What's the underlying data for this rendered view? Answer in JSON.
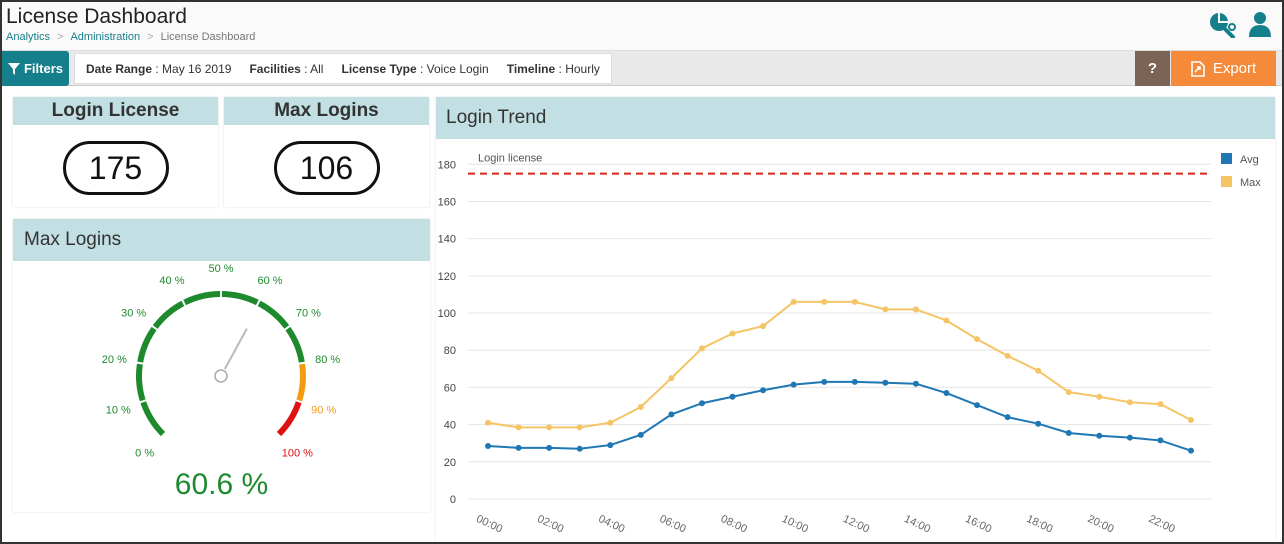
{
  "header": {
    "title": "License Dashboard",
    "breadcrumb": [
      "Analytics",
      "Administration",
      "License Dashboard"
    ],
    "breadcrumb_sep": ">"
  },
  "toolbar": {
    "filters_label": "Filters",
    "filters": [
      {
        "key": "Date Range",
        "value": "May 16 2019"
      },
      {
        "key": "Facilities",
        "value": "All"
      },
      {
        "key": "License Type",
        "value": "Voice Login"
      },
      {
        "key": "Timeline",
        "value": "Hourly"
      }
    ],
    "help_label": "?",
    "export_label": "Export"
  },
  "kpis": [
    {
      "title": "Login License",
      "value": "175"
    },
    {
      "title": "Max Logins",
      "value": "106"
    }
  ],
  "gauge": {
    "title": "Max Logins",
    "value_text": "60.6 %",
    "value": 60.6,
    "tick_labels": [
      "0 %",
      "10 %",
      "20 %",
      "30 %",
      "40 %",
      "50 %",
      "60 %",
      "70 %",
      "80 %",
      "90 %",
      "100 %"
    ],
    "colors": {
      "green": "#1e8a2e",
      "orange": "#f39c12",
      "red": "#e01010"
    }
  },
  "trend": {
    "title": "Login Trend"
  },
  "chart_data": {
    "type": "line",
    "title": "Login Trend",
    "x": [
      "00:00",
      "01:00",
      "02:00",
      "03:00",
      "04:00",
      "05:00",
      "06:00",
      "07:00",
      "08:00",
      "09:00",
      "10:00",
      "11:00",
      "12:00",
      "13:00",
      "14:00",
      "15:00",
      "16:00",
      "17:00",
      "18:00",
      "19:00",
      "20:00",
      "21:00",
      "22:00",
      "23:00"
    ],
    "x_tick_labels": [
      "00:00",
      "02:00",
      "04:00",
      "06:00",
      "08:00",
      "10:00",
      "12:00",
      "14:00",
      "16:00",
      "18:00",
      "20:00",
      "22:00"
    ],
    "series": [
      {
        "name": "Avg",
        "color": "#1f77b4",
        "values": [
          28.5,
          27.5,
          27.5,
          27,
          29,
          34.5,
          45.5,
          51.5,
          55,
          58.5,
          61.5,
          63,
          63,
          62.5,
          62,
          57,
          50.5,
          44,
          40.5,
          35.5,
          34,
          33,
          31.5,
          26
        ]
      },
      {
        "name": "Max",
        "color": "#f5c465",
        "values": [
          41,
          38.5,
          38.5,
          38.5,
          41,
          49.5,
          65,
          81,
          89,
          93,
          106,
          106,
          106,
          102,
          102,
          96,
          86,
          77,
          69,
          57.5,
          55,
          52,
          51,
          42.5
        ]
      }
    ],
    "reference_line": {
      "label": "Login license",
      "value": 175,
      "color": "#d9261c"
    },
    "ylim": [
      0,
      185
    ],
    "yticks": [
      0,
      20,
      40,
      60,
      80,
      100,
      120,
      140,
      160,
      180
    ],
    "legend_position": "top-right",
    "grid": true
  }
}
